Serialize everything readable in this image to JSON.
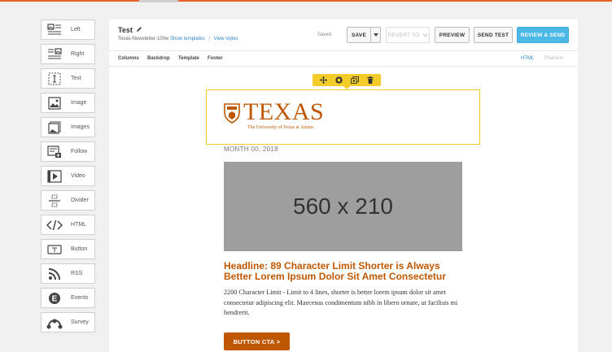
{
  "sidebar": {
    "items": [
      {
        "label": "Left",
        "icon": "image-left-icon"
      },
      {
        "label": "Right",
        "icon": "image-right-icon"
      },
      {
        "label": "Text",
        "icon": "text-cursor-icon"
      },
      {
        "label": "Image",
        "icon": "image-icon"
      },
      {
        "label": "Images",
        "icon": "images-icon"
      },
      {
        "label": "Follow",
        "icon": "follow-icon"
      },
      {
        "label": "Video",
        "icon": "video-icon"
      },
      {
        "label": "Divider",
        "icon": "divider-icon"
      },
      {
        "label": "HTML",
        "icon": "code-icon"
      },
      {
        "label": "Button",
        "icon": "button-icon"
      },
      {
        "label": "RSS",
        "icon": "rss-icon"
      },
      {
        "label": "Events",
        "icon": "events-icon"
      },
      {
        "label": "Survey",
        "icon": "survey-icon"
      }
    ]
  },
  "header": {
    "title": "Test",
    "template_name": "Texas-Newsletter-100w",
    "show_templates": "Show templates",
    "separator": "|",
    "view_styles": "View styles",
    "status": "Saved.",
    "save": "SAVE",
    "revert": "REVERT TO",
    "preview": "PREVIEW",
    "send_test": "SEND TEST",
    "review_send": "REVIEW & SEND"
  },
  "tabs": {
    "columns": "Columns",
    "backdrop": "Backdrop",
    "template": "Template",
    "footer": "Footer",
    "html": "HTML",
    "plaintext": "Plaintext"
  },
  "email": {
    "logo_word": "TEXAS",
    "logo_sub": "The University of Texas at Austin",
    "date": "MONTH 00, 2018",
    "placeholder": "560 x 210",
    "headline": "Headline: 89 Character Limit Shorter is Always Better Lorem Ipsum Dolor Sit Amet Consectetur",
    "body": "2200 Character Limit - Limit to 4 lines, shorter is better lorem ipsum dolor sit amet consectetur adipiscing elit. Maecenas condimentum nibh in libero ornare, ut facilisis mi hendrerit.",
    "cta": "BUTTON CTA >"
  },
  "colors": {
    "accent": "#bf5700",
    "selection": "#f4cc2a",
    "primary_button": "#4cb8e6",
    "link": "#2a86c9",
    "top_bar": "#e8612c"
  }
}
